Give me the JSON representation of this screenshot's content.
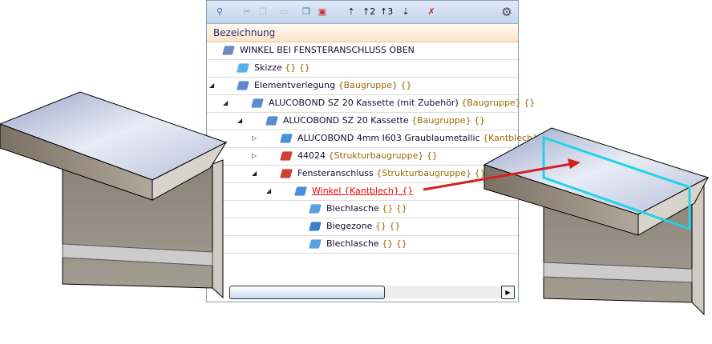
{
  "toolbar": {
    "icons": [
      "search-icon",
      "cut-icon",
      "copy-icon",
      "paste-icon",
      "copy-special-icon",
      "paste-special-icon",
      "level-1-icon",
      "level-2-icon",
      "level-3-icon",
      "expand-all-icon",
      "sort-clear-icon",
      "settings-icon"
    ]
  },
  "header": {
    "column": "Bezeichnung"
  },
  "tree": [
    {
      "name": "WINKEL BEI FENSTERANSCHLUSS OBEN",
      "suffix": "",
      "icon": "assembly-icon",
      "expander": ""
    },
    {
      "name": "Skizze",
      "suffix": "{} {}",
      "icon": "sketch-icon",
      "expander": ""
    },
    {
      "name": "Elementverlegung",
      "suffix": "{Baugruppe} {}",
      "icon": "assembly-group-icon",
      "expander": "◢"
    },
    {
      "name": "ALUCOBOND SZ 20 Kassette (mit Zubehör)",
      "suffix": "{Baugruppe} {}",
      "icon": "assembly-group-icon",
      "expander": "◢"
    },
    {
      "name": "ALUCOBOND SZ 20 Kassette",
      "suffix": "{Baugruppe} {}",
      "icon": "assembly-group-icon",
      "expander": "◢"
    },
    {
      "name": "ALUCOBOND 4mm I603 Graublaumetallic",
      "suffix": "{Kantblech} {}",
      "icon": "sheet-metal-main-icon",
      "expander": "▷"
    },
    {
      "name": "44024",
      "suffix": "{Strukturbaugruppe} {}",
      "icon": "structure-assembly-icon",
      "expander": "▷"
    },
    {
      "name": "Fensteranschluss",
      "suffix": "{Strukturbaugruppe} {}",
      "icon": "structure-assembly-icon",
      "expander": "◢"
    },
    {
      "name": "Winkel {Kantblech} {}",
      "suffix": "",
      "icon": "sheet-metal-icon",
      "expander": "◢",
      "selected": true
    },
    {
      "name": "Blechlasche",
      "suffix": "{} {}",
      "icon": "flange-icon",
      "expander": ""
    },
    {
      "name": "Biegezone",
      "suffix": "{} {}",
      "icon": "bend-zone-icon",
      "expander": ""
    },
    {
      "name": "Blechlasche",
      "suffix": "{} {}",
      "icon": "flange-icon",
      "expander": ""
    }
  ],
  "colors": {
    "selected": "#e00000",
    "highlight": "#22d3e8",
    "arrow": "#d42020"
  }
}
